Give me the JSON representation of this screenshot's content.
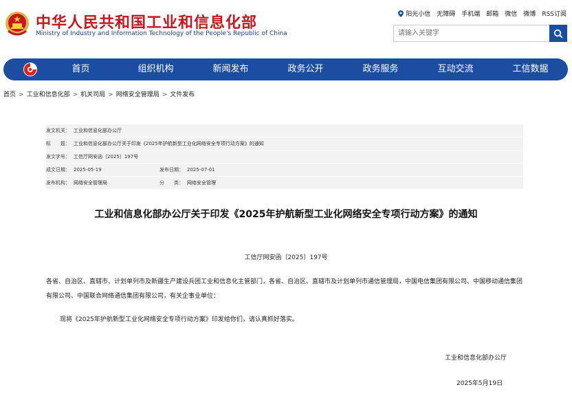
{
  "header": {
    "title_cn": "中华人民共和国工业和信息化部",
    "title_en": "Ministry of Industry and Information Technology of the People's Republic of China",
    "links": [
      "阳光小信",
      "无障碍",
      "手机端",
      "邮箱",
      "微信",
      "微博",
      "RSS订阅"
    ],
    "search_placeholder": "请输入关键字"
  },
  "nav": {
    "items": [
      "首页",
      "组织机构",
      "新闻发布",
      "政务公开",
      "政务服务",
      "互动交流",
      "工信数据"
    ]
  },
  "breadcrumb": [
    "首页",
    "工业和信息化部",
    "机关司局",
    "网络安全管理局",
    "文件发布"
  ],
  "meta": {
    "issuer_label": "发文机关：",
    "issuer": "工业和信息化部办公厅",
    "subject_label": "标　　题：",
    "subject": "工业和信息化部办公厅关于印发《2025年护航新型工业化网络安全专项行动方案》的通知",
    "docno_label": "发文字号：",
    "docno": "工信厅网安函〔2025〕197号",
    "date_label": "成文日期：",
    "date": "2025-05-19",
    "pubdate_label": "发布日期：",
    "pubdate": "2025-07-01",
    "org_label": "发布机构：",
    "org": "网络安全管理局",
    "cat_label": "分　　类：",
    "cat": "网络安全管理"
  },
  "document": {
    "title": "工业和信息化部办公厅关于印发《2025年护航新型工业化网络安全专项行动方案》的通知",
    "number": "工信厅网安函〔2025〕197号",
    "para1": "各省、自治区、直辖市、计划单列市及新疆生产建设兵团工业和信息化主管部门，各省、自治区、直辖市及计划单列市通信管理局，中国电信集团有限公司、中国移动通信集团有限公司、中国联合网络通信集团有限公司，有关企事业单位：",
    "para2": "现将《2025年护航新型工业化网络安全专项行动方案》印发给你们，请认真抓好落实。",
    "signature": "工业和信息化部办公厅",
    "date": "2025年5月19日"
  },
  "colors": {
    "brand_red": "#c8161e",
    "nav_blue": "#1b4ea1"
  }
}
